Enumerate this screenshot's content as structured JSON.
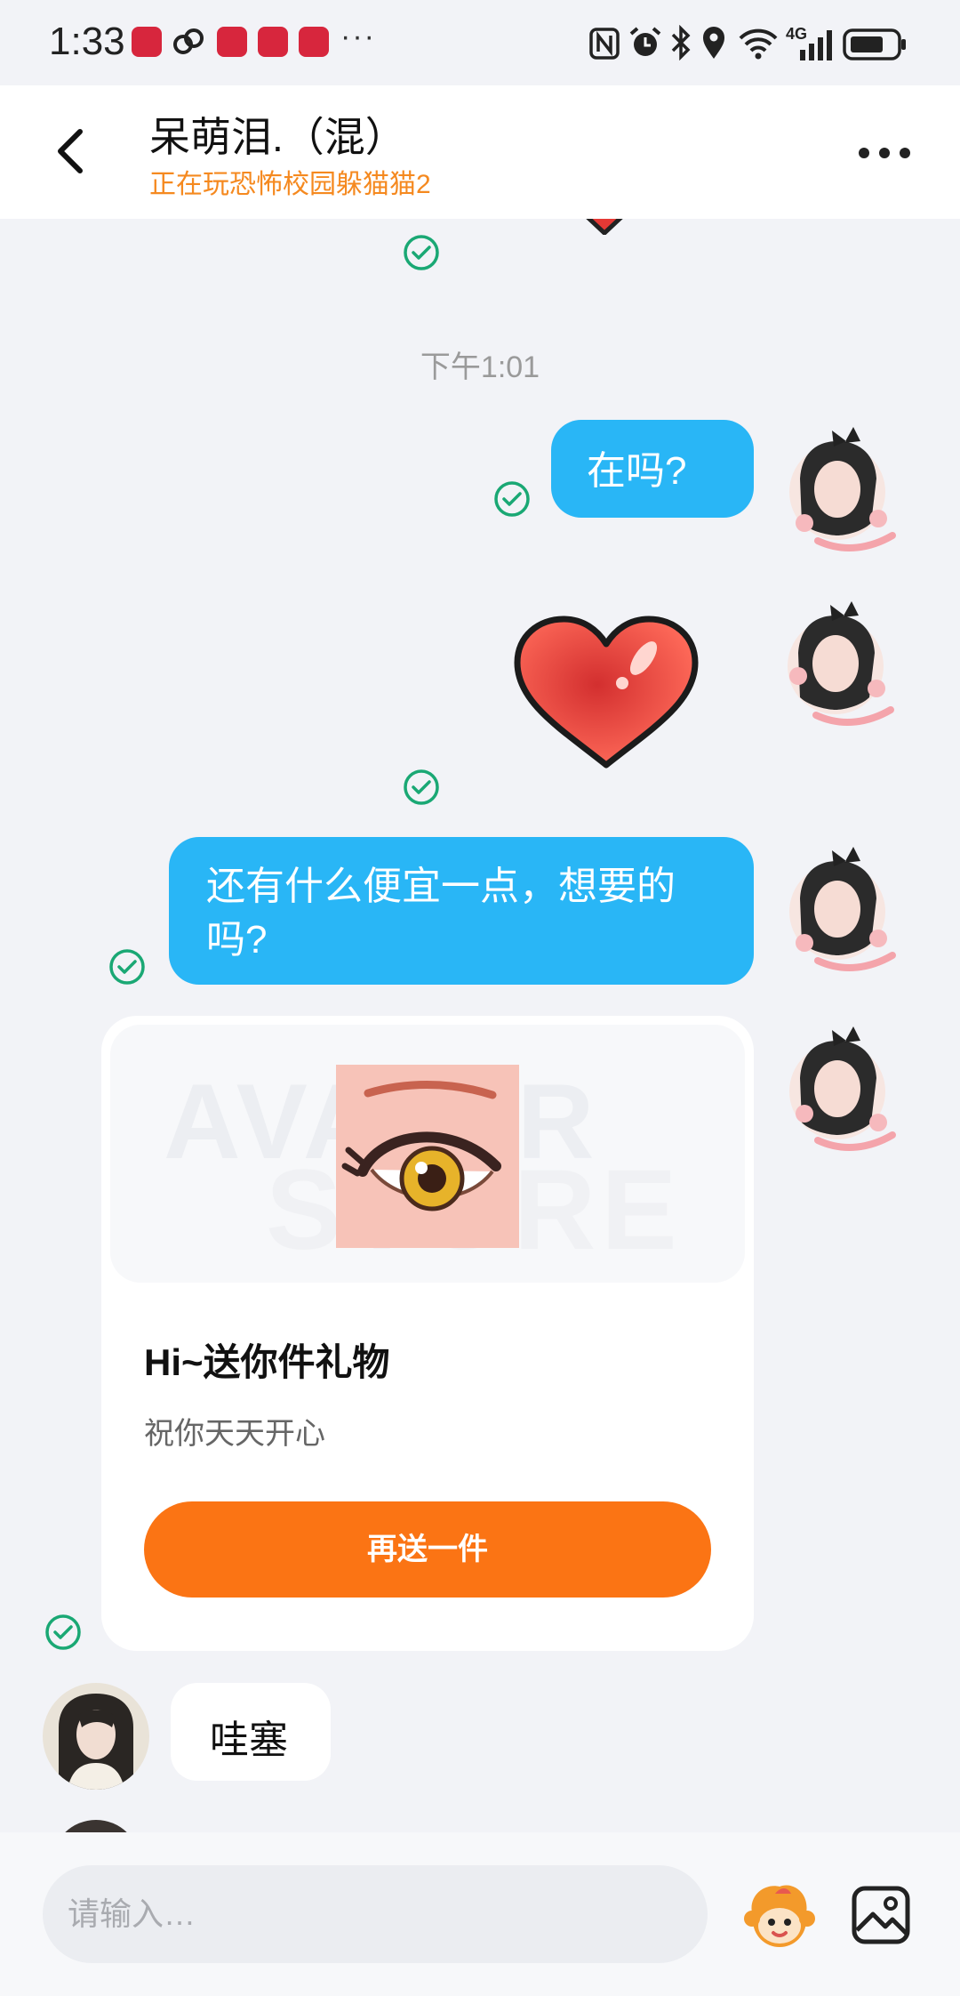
{
  "status_bar": {
    "time": "1:33",
    "more": "···",
    "network": "4G"
  },
  "header": {
    "title": "呆萌泪.（混）",
    "subtitle": "正在玩恐怖校园躲猫猫2"
  },
  "messages": {
    "timestamp": "下午1:01",
    "msg1": "在吗?",
    "msg3_line1": "还有什么便宜一点，想要的",
    "msg3_line2": "吗?",
    "incoming": "哇塞"
  },
  "gift": {
    "watermark_top": "AVATAR",
    "watermark_bottom": "STORE",
    "title": "Hi~送你件礼物",
    "subtitle": "祝你天天开心",
    "button": "再送一件"
  },
  "input": {
    "placeholder": "请输入…"
  },
  "colors": {
    "bubble": "#29b6f6",
    "accent": "#fb7414",
    "subtitle": "#f5891f",
    "check": "#1aa874"
  }
}
